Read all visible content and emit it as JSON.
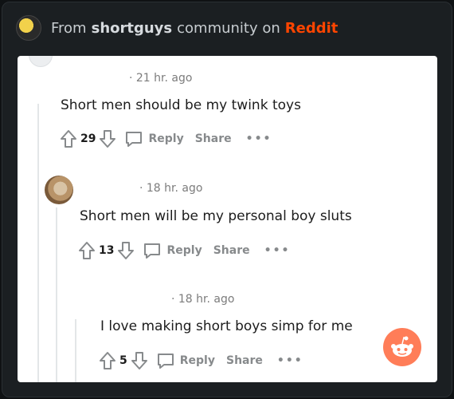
{
  "header": {
    "prefix": "From",
    "subreddit": "shortguys",
    "middle": "community on",
    "brand": "Reddit"
  },
  "comments": [
    {
      "time": "· 21 hr. ago",
      "text": "Short men should be my twink toys",
      "votes": "29",
      "reply": "Reply",
      "share": "Share",
      "more": "•••"
    },
    {
      "time": "· 18 hr. ago",
      "text": "Short men will be my personal boy sluts",
      "votes": "13",
      "reply": "Reply",
      "share": "Share",
      "more": "•••"
    },
    {
      "time": "· 18 hr. ago",
      "text": "I love making short boys simp for me",
      "votes": "5",
      "reply": "Reply",
      "share": "Share",
      "more": "•••"
    }
  ],
  "colors": {
    "brand": "#ff4500",
    "fab": "#ff7d58"
  }
}
